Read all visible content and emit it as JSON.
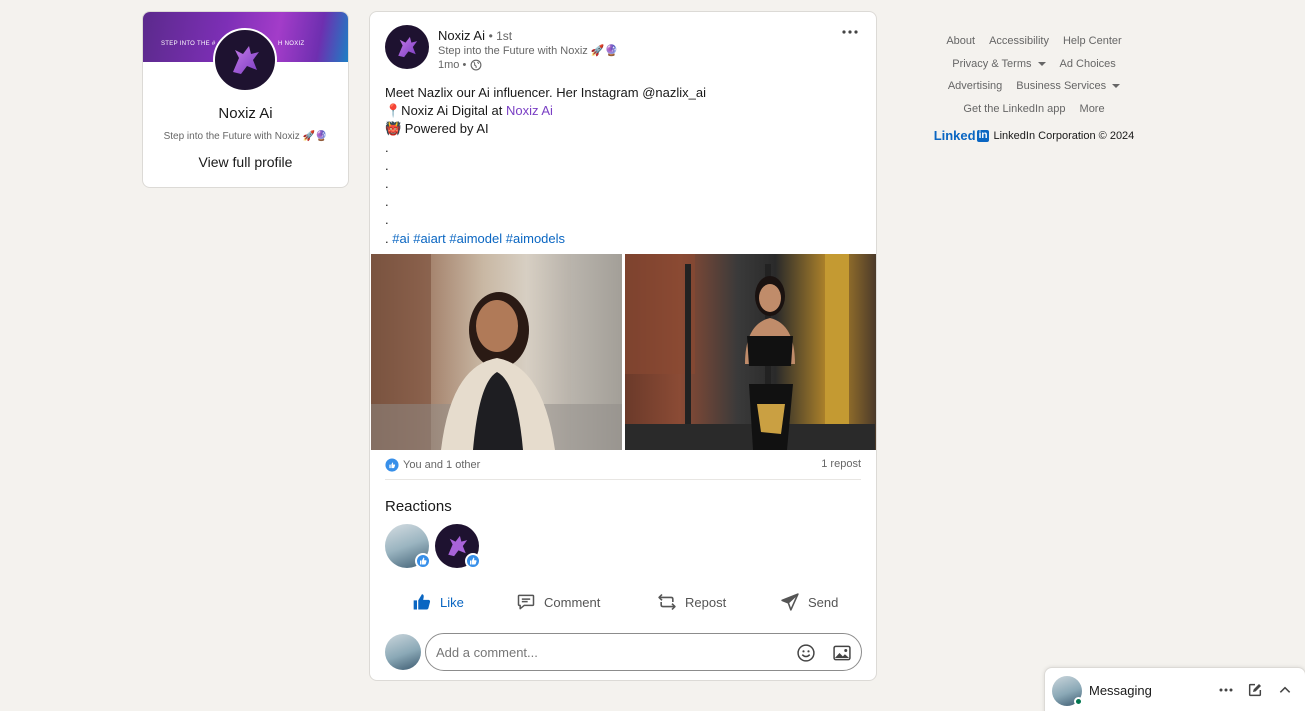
{
  "profile_card": {
    "banner_left_text": "STEP INTO THE #",
    "banner_right_text": "H NOXIZ",
    "name": "Noxiz Ai",
    "headline": "Step into the Future with Noxiz 🚀🔮",
    "view_profile": "View full profile"
  },
  "post": {
    "author_name": "Noxiz Ai",
    "degree": "• 1st",
    "author_headline": "Step into the Future with Noxiz 🚀🔮",
    "time": "1mo •",
    "lines": [
      "Meet Nazlix our Ai influencer. Her Instagram @nazlix_ai",
      "📍Noxiz Ai Digital at ",
      "👹 Powered by AI",
      ".",
      ".",
      ".",
      ".",
      ".",
      ". "
    ],
    "company_link": "Noxiz Ai",
    "hashtags": [
      "#ai",
      "#aiart",
      "#aimodel",
      "#aimodels"
    ],
    "reactions_summary": "You and 1 other",
    "reposts": "1 repost",
    "reactions_title": "Reactions"
  },
  "actions": {
    "like": "Like",
    "comment": "Comment",
    "repost": "Repost",
    "send": "Send"
  },
  "comment": {
    "placeholder": "Add a comment..."
  },
  "footer": {
    "about": "About",
    "accessibility": "Accessibility",
    "help_center": "Help Center",
    "privacy_terms": "Privacy & Terms",
    "ad_choices": "Ad Choices",
    "advertising": "Advertising",
    "business_services": "Business Services",
    "get_app": "Get the LinkedIn app",
    "more": "More",
    "logo_text": "Linked",
    "logo_in": "in",
    "copyright": "LinkedIn Corporation © 2024"
  },
  "messaging": {
    "label": "Messaging"
  },
  "colors": {
    "background": "#f4f2ee",
    "linkedin_blue": "#0a66c2",
    "company_link": "#7a3fc4",
    "online": "#01754f"
  }
}
